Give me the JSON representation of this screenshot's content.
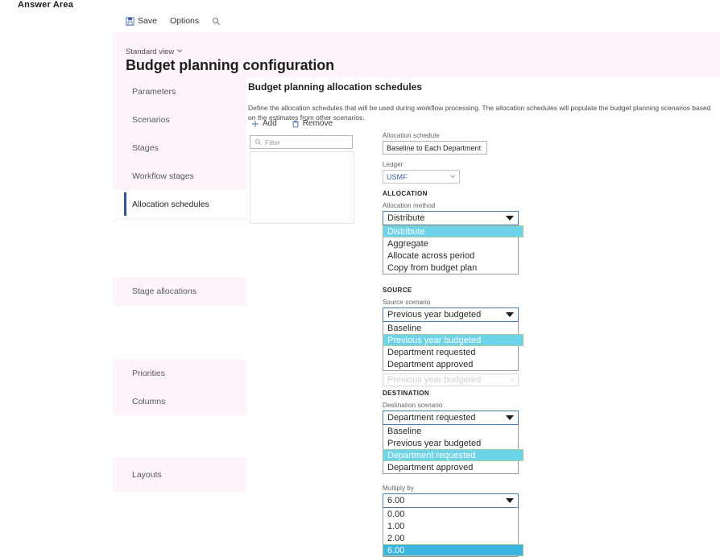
{
  "answer_area_label": "Answer Area",
  "command_bar": {
    "save_label": "Save",
    "options_label": "Options",
    "search_icon": "search-icon",
    "save_icon": "save-disk-icon"
  },
  "header": {
    "view_selector": "Standard view",
    "view_chevron": "chevron-down-icon",
    "title": "Budget planning configuration"
  },
  "sidebar": {
    "groups": [
      {
        "items": [
          {
            "label": "Parameters",
            "active": false
          },
          {
            "label": "Scenarios",
            "active": false
          },
          {
            "label": "Stages",
            "active": false
          },
          {
            "label": "Workflow stages",
            "active": false
          },
          {
            "label": "Allocation schedules",
            "active": true
          }
        ]
      },
      {
        "items": [
          {
            "label": "Stage allocations",
            "active": false
          }
        ]
      },
      {
        "items": [
          {
            "label": "Priorities",
            "active": false
          },
          {
            "label": "Columns",
            "active": false
          }
        ]
      },
      {
        "items": [
          {
            "label": "Layouts",
            "active": false
          }
        ]
      }
    ]
  },
  "main": {
    "section_title": "Budget planning allocation schedules",
    "section_description": "Define the allocation schedules that will be used during workflow processing. The allocation schedules will populate the budget planning scenarios based on the estimates from other scenarios.",
    "toolbar": {
      "add_label": "Add",
      "add_icon": "plus-icon",
      "remove_label": "Remove",
      "remove_icon": "trash-icon"
    },
    "filter": {
      "placeholder": "Filter",
      "icon": "search-icon",
      "value": ""
    }
  },
  "form": {
    "allocation_schedule": {
      "label": "Allocation schedule",
      "value": "Baseline to Each Department"
    },
    "ledger": {
      "label": "Ledger",
      "value": "USMF",
      "chevron": "chevron-down-icon"
    },
    "allocation_section": {
      "heading": "ALLOCATION",
      "allocation_method": {
        "label": "Allocation method",
        "value": "Distribute",
        "expanded": true,
        "options": [
          {
            "label": "Distribute",
            "selected": true
          },
          {
            "label": "Aggregate",
            "selected": false
          },
          {
            "label": "Allocate across period",
            "selected": false
          },
          {
            "label": "Copy from budget plan",
            "selected": false
          }
        ]
      }
    },
    "source_section": {
      "heading": "SOURCE",
      "source_scenario": {
        "label": "Source scenario",
        "value": "Previous year budgeted",
        "expanded": true,
        "options": [
          {
            "label": "Baseline",
            "selected": false
          },
          {
            "label": "Previous year budgeted",
            "selected": true
          },
          {
            "label": "Department requested",
            "selected": false
          },
          {
            "label": "Department approved",
            "selected": false
          }
        ],
        "occluded_field_value": "Previous year budgeted"
      }
    },
    "destination_section": {
      "heading": "DESTINATION",
      "destination_scenario": {
        "label": "Destination scenario",
        "value": "Department requested",
        "expanded": true,
        "options": [
          {
            "label": "Baseline",
            "selected": false
          },
          {
            "label": "Previous year budgeted",
            "selected": false
          },
          {
            "label": "Department requested",
            "selected": true
          },
          {
            "label": "Department approved",
            "selected": false
          }
        ]
      }
    },
    "multiply_by": {
      "label": "Multiply by",
      "value": "6.00",
      "expanded": true,
      "options": [
        {
          "label": "0.00",
          "selected": false
        },
        {
          "label": "1.00",
          "selected": false
        },
        {
          "label": "2.00",
          "selected": false
        },
        {
          "label": "6.00",
          "selected": true
        }
      ]
    }
  },
  "colors": {
    "header_band": "#fdf4fc",
    "sidebar_band": "#fdf4fc",
    "active_accent": "#2b579a",
    "highlight_teal": "#6dd3e8",
    "highlight_blue": "#3bb4e0",
    "highlight_border": "#a8c8a0",
    "link_blue": "#3b62a8",
    "combo_border": "#4a7bb5"
  }
}
